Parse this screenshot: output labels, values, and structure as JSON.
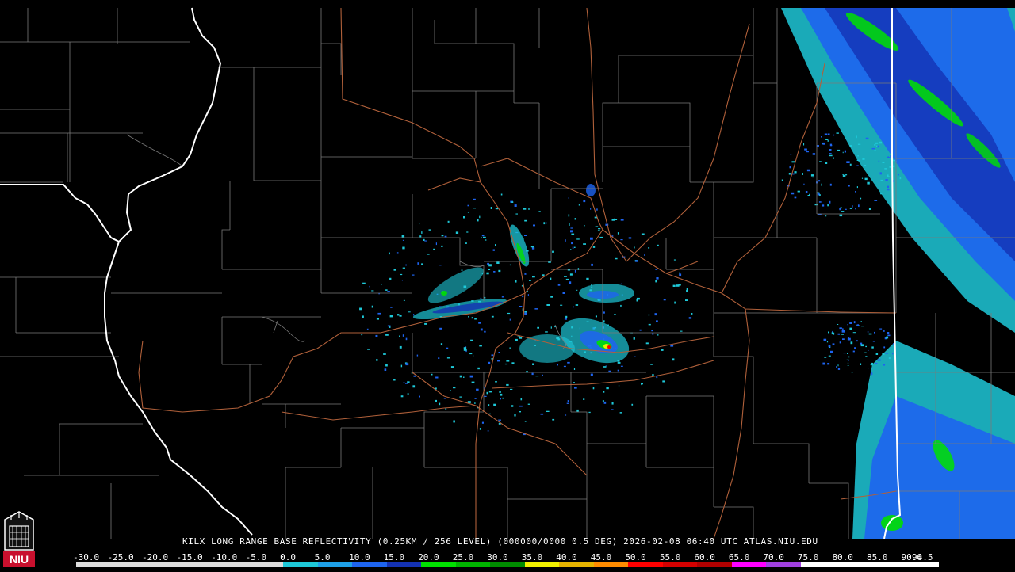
{
  "product": {
    "caption": "KILX LONG RANGE BASE REFLECTIVITY (0.25KM / 256 LEVEL) (000000/0000 0.5 DEG) 2026-02-08 06:40 UTC  ATLAS.NIU.EDU"
  },
  "logo": {
    "text": "NIU",
    "bg_color": "#c8102e"
  },
  "legend": {
    "labels": [
      "-30.0",
      "-25.0",
      "-20.0",
      "-15.0",
      "-10.0",
      "-5.0",
      "0.0",
      "5.0",
      "10.0",
      "15.0",
      "20.0",
      "25.0",
      "30.0",
      "35.0",
      "40.0",
      "45.0",
      "50.0",
      "55.0",
      "60.0",
      "65.0",
      "70.0",
      "75.0",
      "80.0",
      "85.0",
      "90.0",
      "94.5"
    ],
    "colors": [
      "#dddddd",
      "#dddddd",
      "#dddddd",
      "#dddddd",
      "#dddddd",
      "#dddddd",
      "#1ec8d8",
      "#1ea0e8",
      "#1e64f0",
      "#1432b4",
      "#00e000",
      "#00b400",
      "#008c00",
      "#f0f000",
      "#e6b400",
      "#ff8c00",
      "#ff0000",
      "#d40000",
      "#b00000",
      "#ff00ff",
      "#a040e0",
      "#ffffff",
      "#ffffff",
      "#ffffff",
      "#ffffff"
    ]
  },
  "colors": {
    "county_lines": "#7a7a7a",
    "state_lines": "#ffffff",
    "roads": "#b0603a",
    "echo_light": "#1ec8d8",
    "echo_moderate": "#1e64f0",
    "echo_dark": "#1432b4",
    "echo_green": "#00e000",
    "echo_yellow": "#f0f000",
    "echo_red": "#ff0000"
  }
}
